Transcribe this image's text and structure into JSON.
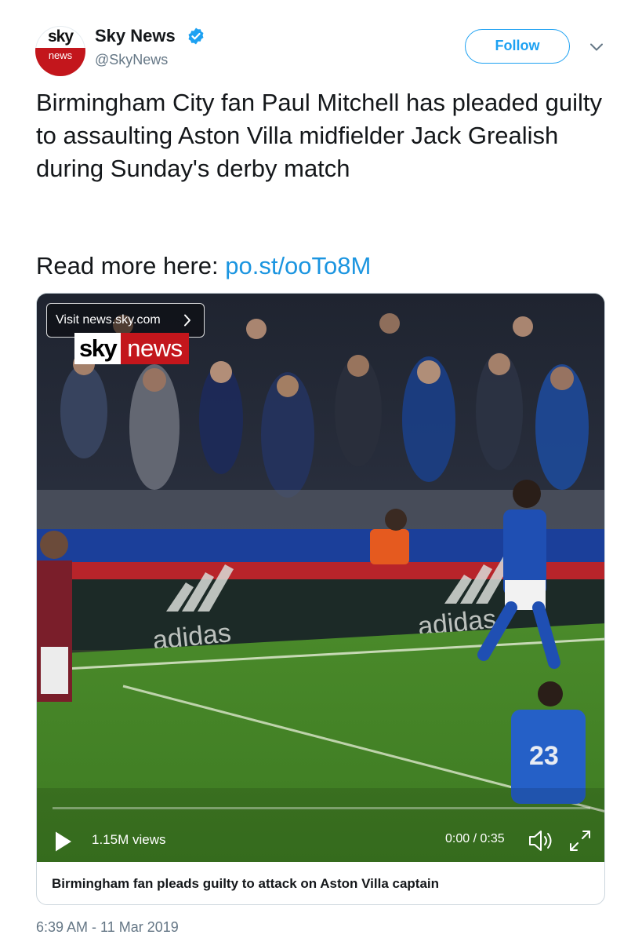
{
  "account": {
    "display_name": "Sky News",
    "handle": "@SkyNews",
    "avatar_sky_text": "sky",
    "avatar_news_text": "news",
    "verified": true
  },
  "actions": {
    "follow_label": "Follow"
  },
  "tweet": {
    "text": "Birmingham City fan Paul Mitchell has pleaded guilty to assaulting Aston Villa midfielder Jack Grealish during Sunday's derby match",
    "read_more_prefix": "Read more here: ",
    "link_text": "po.st/ooTo8M",
    "timestamp": "6:39 AM - 11 Mar 2019"
  },
  "media": {
    "visit_label": "Visit news.sky.com",
    "logo_sky": "sky",
    "logo_news": "news",
    "board_brand": "adidas",
    "player_number": "23",
    "views": "1.15M views",
    "time": "0:00 / 0:35",
    "progress_fraction": 0,
    "caption": "Birmingham fan pleads guilty to attack on Aston Villa captain"
  },
  "icons": {
    "verified": "verified-badge-icon",
    "menu": "chevron-down-icon",
    "play": "play-icon",
    "volume": "volume-icon",
    "fullscreen": "fullscreen-icon"
  },
  "colors": {
    "accent_blue": "#1da1f2",
    "link_blue": "#1b95e0",
    "sky_red": "#c3161c",
    "secondary_text": "#657786",
    "primary_text": "#14171a",
    "border": "#ccd6dd"
  }
}
